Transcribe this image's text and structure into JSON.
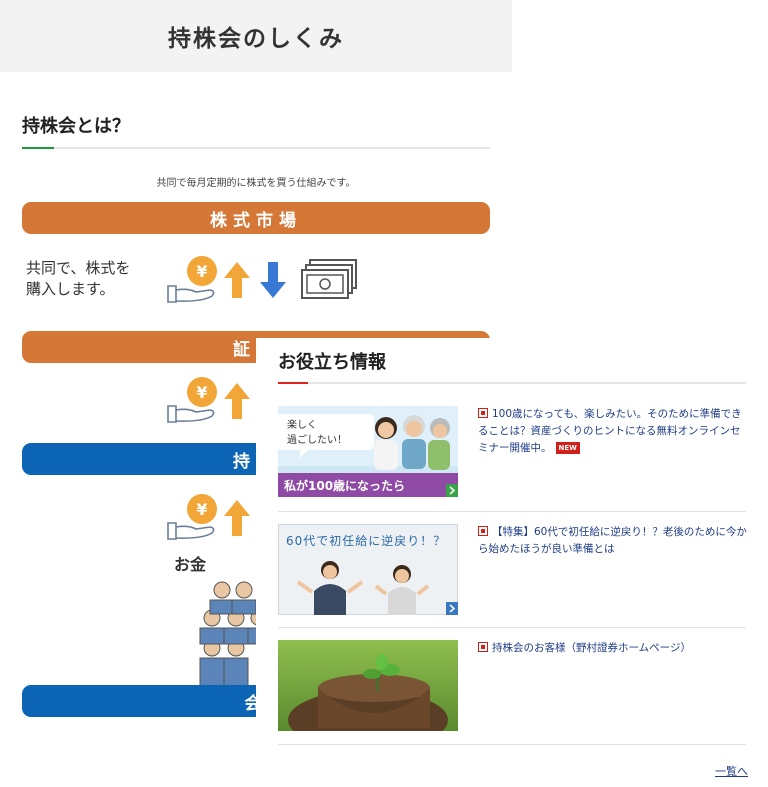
{
  "header": {
    "title": "持株会のしくみ"
  },
  "section": {
    "title": "持株会とは？",
    "intro": "共同で毎月定期的に株式を買う仕組みです。"
  },
  "flow": {
    "market_label": "株式市場",
    "broker_label": "証券",
    "assoc_label": "持株",
    "member_label": "会",
    "side_text_line1": "共同で、株式を",
    "side_text_line2": "購入します。",
    "money_label": "お金",
    "coin_symbol": "¥",
    "colors": {
      "orange": "#d57736",
      "blue": "#0b64b4",
      "coin": "#f1a637",
      "arrow_up": "#f1a637",
      "arrow_down": "#3a78d6"
    }
  },
  "useful": {
    "title": "お役立ち情報",
    "items": [
      {
        "text": "100歳になっても、楽しみたい。そのために準備できることは？資産づくりのヒントになる無料オンラインセミナー開催中。",
        "badge": "NEW",
        "thumb": {
          "bubble_line1": "楽しく",
          "bubble_line2": "過ごしたい！",
          "banner": "私が100歳になったら"
        }
      },
      {
        "text": "【特集】60代で初任給に逆戻り！？老後のために今から始めたほうが良い準備とは",
        "thumb": {
          "caption": "60代で初任給に逆戻り！？"
        }
      },
      {
        "text": "持株会のお客様（野村證券ホームページ）"
      }
    ],
    "more_link": "一覧へ"
  }
}
